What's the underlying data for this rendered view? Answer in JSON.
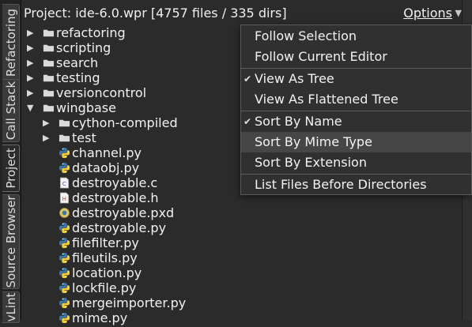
{
  "vertical_tabs": [
    {
      "label": "Refactoring"
    },
    {
      "label": "Call Stack"
    },
    {
      "label": "Project"
    },
    {
      "label": "Source Browser"
    },
    {
      "label": "vLint"
    }
  ],
  "header": {
    "title": "Project: ide-6.0.wpr [4757 files / 335 dirs]",
    "options_label": "Options",
    "options_arrow": "▼"
  },
  "tree": [
    {
      "label": "refactoring",
      "type": "folder",
      "expanded": false,
      "depth": 0
    },
    {
      "label": "scripting",
      "type": "folder",
      "expanded": false,
      "depth": 0
    },
    {
      "label": "search",
      "type": "folder",
      "expanded": false,
      "depth": 0
    },
    {
      "label": "testing",
      "type": "folder",
      "expanded": false,
      "depth": 0
    },
    {
      "label": "versioncontrol",
      "type": "folder",
      "expanded": false,
      "depth": 0
    },
    {
      "label": "wingbase",
      "type": "folder",
      "expanded": true,
      "depth": 0
    },
    {
      "label": "cython-compiled",
      "type": "folder",
      "expanded": false,
      "depth": 1
    },
    {
      "label": "test",
      "type": "folder",
      "expanded": false,
      "depth": 1
    },
    {
      "label": "channel.py",
      "type": "python",
      "depth": 1
    },
    {
      "label": "dataobj.py",
      "type": "python",
      "depth": 1
    },
    {
      "label": "destroyable.c",
      "type": "c",
      "depth": 1
    },
    {
      "label": "destroyable.h",
      "type": "h",
      "depth": 1
    },
    {
      "label": "destroyable.pxd",
      "type": "pxd",
      "depth": 1
    },
    {
      "label": "destroyable.py",
      "type": "python",
      "depth": 1
    },
    {
      "label": "filefilter.py",
      "type": "python",
      "depth": 1
    },
    {
      "label": "fileutils.py",
      "type": "python",
      "depth": 1
    },
    {
      "label": "location.py",
      "type": "python",
      "depth": 1
    },
    {
      "label": "lockfile.py",
      "type": "python",
      "depth": 1
    },
    {
      "label": "mergeimporter.py",
      "type": "python",
      "depth": 1
    },
    {
      "label": "mime.py",
      "type": "python",
      "depth": 1
    }
  ],
  "options_menu": {
    "items": [
      {
        "label": "Follow Selection",
        "checked": false,
        "highlighted": false
      },
      {
        "label": "Follow Current Editor",
        "checked": false,
        "highlighted": false
      },
      {
        "separator": true
      },
      {
        "label": "View As Tree",
        "checked": true,
        "highlighted": false
      },
      {
        "label": "View As Flattened Tree",
        "checked": false,
        "highlighted": false
      },
      {
        "separator": true
      },
      {
        "label": "Sort By Name",
        "checked": true,
        "highlighted": false
      },
      {
        "label": "Sort By Mime Type",
        "checked": false,
        "highlighted": true
      },
      {
        "label": "Sort By Extension",
        "checked": false,
        "highlighted": false
      },
      {
        "separator": true
      },
      {
        "label": "List Files Before Directories",
        "checked": false,
        "highlighted": false
      }
    ],
    "check_glyph": "✔"
  },
  "colors": {
    "background": "#2b2b2b",
    "folder": "#d9d9d9",
    "python_blue": "#3b77a8",
    "python_yellow": "#f2cf3a",
    "menu_highlight": "#464646"
  }
}
